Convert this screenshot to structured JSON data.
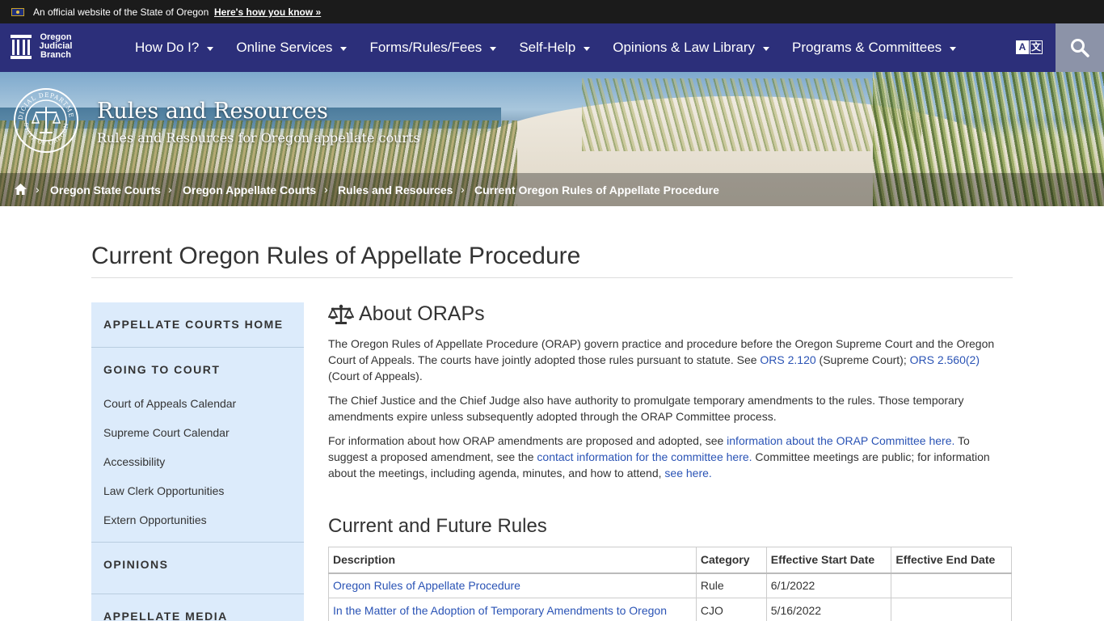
{
  "banner": {
    "official_text": "An official website of the State of Oregon",
    "how_you_know": "Here's how you know »"
  },
  "nav": {
    "logo_lines": [
      "Oregon",
      "Judicial",
      "Branch"
    ],
    "items": [
      {
        "label": "How Do I?"
      },
      {
        "label": "Online Services"
      },
      {
        "label": "Forms/Rules/Fees"
      },
      {
        "label": "Self-Help"
      },
      {
        "label": "Opinions & Law Library"
      },
      {
        "label": "Programs & Committees"
      }
    ],
    "translate_left": "A",
    "translate_right": "文"
  },
  "hero": {
    "title": "Rules and Resources",
    "subtitle": "Rules and Resources for Oregon appellate courts",
    "seal_text_top": "JUDICIAL DEPARTMENT",
    "seal_text_bottom": "STATE OF OREGON"
  },
  "breadcrumb": {
    "items": [
      "Oregon State Courts",
      "Oregon Appellate Courts",
      "Rules and Resources",
      "Current Oregon Rules of Appellate Procedure"
    ]
  },
  "page": {
    "title": "Current Oregon Rules of Appellate Procedure"
  },
  "sidebar": {
    "sections": {
      "home": "APPELLATE COURTS HOME",
      "going": "GOING TO COURT",
      "opinions": "OPINIONS",
      "media": "APPELLATE MEDIA"
    },
    "links": [
      "Court of Appeals Calendar",
      "Supreme Court Calendar",
      "Accessibility",
      "Law Clerk Opportunities",
      "Extern Opportunities"
    ]
  },
  "about": {
    "heading": "About ORAPs",
    "p1_a": "The Oregon Rules of Appellate Procedure (ORAP) govern practice and procedure before the Oregon Supreme Court and the Oregon Court of Appeals.  The courts have jointly adopted those rules pursuant to statute.  See ",
    "p1_link1": "ORS 2.120",
    "p1_b": " (Supreme Court); ",
    "p1_link2": "ORS 2.560(2)",
    "p1_c": " (Court of Appeals).",
    "p2": "The Chief Justice and the Chief Judge also have authority to promulgate temporary amendments to the rules.  Those temporary amendments expire unless subsequently adopted through the ORAP Committee process.",
    "p3_a": "For information about how ORAP amendments are proposed and adopted, see ",
    "p3_link1": "information about the ORAP Committee here.",
    "p3_b": "  To suggest a proposed amendment, see the ",
    "p3_link2": "contact information for the committee here.",
    "p3_c": "  Committee meetings are public; for information about the meetings, including agenda, minutes, and how to attend, ",
    "p3_link3": "see here."
  },
  "rules": {
    "heading": "Current and Future Rules",
    "columns": [
      "Description",
      "Category",
      "Effective Start Date",
      "Effective End Date"
    ],
    "rows": [
      {
        "description": "Oregon Rules of Appellate Procedure",
        "category": "Rule",
        "start": "6/1/2022",
        "end": ""
      },
      {
        "description": "In the Matter of the Adoption of Temporary Amendments to Oregon",
        "category": "CJO",
        "start": "5/16/2022",
        "end": ""
      }
    ]
  }
}
